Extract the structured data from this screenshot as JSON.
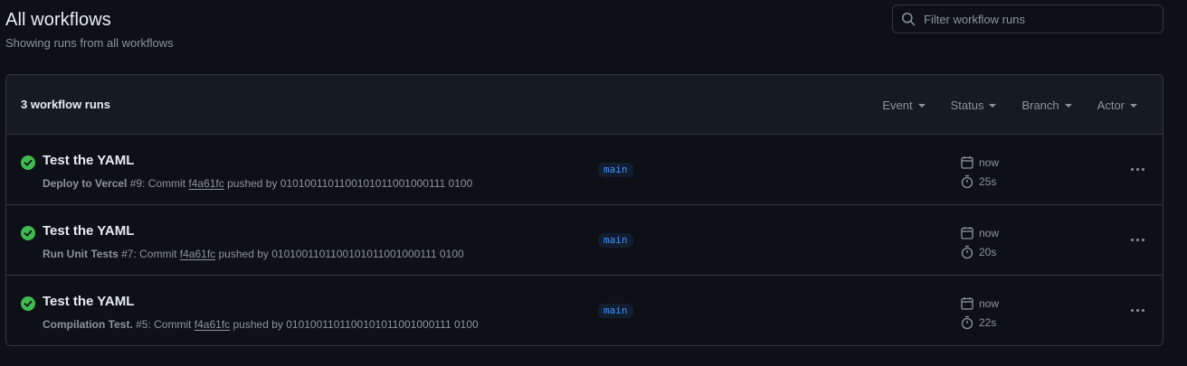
{
  "header": {
    "title": "All workflows",
    "subtitle": "Showing runs from all workflows"
  },
  "search": {
    "placeholder": "Filter workflow runs",
    "icon": "search-icon"
  },
  "list": {
    "count_label": "3 workflow runs",
    "filters": [
      {
        "label": "Event"
      },
      {
        "label": "Status"
      },
      {
        "label": "Branch"
      },
      {
        "label": "Actor"
      }
    ],
    "runs": [
      {
        "status": "success",
        "title": "Test the YAML",
        "workflow": "Deploy to Vercel",
        "run_number": " #9: Commit ",
        "sha": "f4a61fc",
        "pushed_by": " pushed by 0101001101100101011001000111 0100",
        "branch": "main",
        "time": "now",
        "duration": "25s"
      },
      {
        "status": "success",
        "title": "Test the YAML",
        "workflow": "Run Unit Tests",
        "run_number": " #7: Commit ",
        "sha": "f4a61fc",
        "pushed_by": " pushed by 0101001101100101011001000111 0100",
        "branch": "main",
        "time": "now",
        "duration": "20s"
      },
      {
        "status": "success",
        "title": "Test the YAML",
        "workflow": "Compilation Test.",
        "run_number": " #5: Commit ",
        "sha": "f4a61fc",
        "pushed_by": " pushed by 0101001101100101011001000111 0100",
        "branch": "main",
        "time": "now",
        "duration": "22s"
      }
    ]
  },
  "colors": {
    "background": "#0d1117",
    "border": "#30363d",
    "success": "#3fb950",
    "link": "#4493f8",
    "muted": "#8b949e"
  }
}
